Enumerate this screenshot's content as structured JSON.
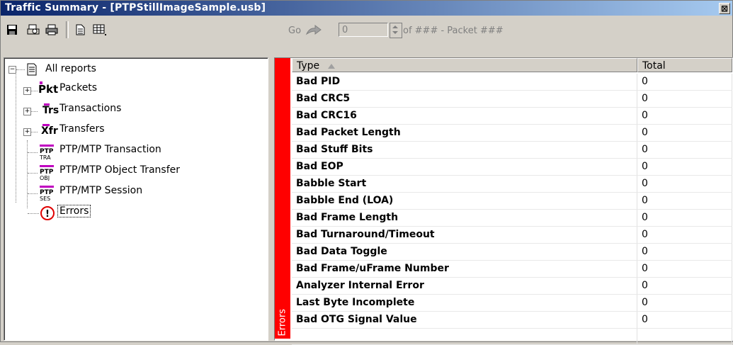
{
  "window": {
    "title": "Traffic Summary - [PTPStillImageSample.usb]",
    "close_glyph": "⊠"
  },
  "toolbar_left": {
    "icons": [
      "save-icon",
      "print-preview-icon",
      "print-icon",
      "report-icon",
      "table-view-icon"
    ]
  },
  "navigator": {
    "go_label": "Go",
    "input_value": "0",
    "of_text": "of ### - Packet ###"
  },
  "tree": {
    "root": "All reports",
    "items": [
      {
        "icon": "Pkt",
        "label": "Packets"
      },
      {
        "icon": "Trs",
        "label": "Transactions"
      },
      {
        "icon": "Xfr",
        "label": "Transfers"
      },
      {
        "icon": "PTP TRA",
        "label": "PTP/MTP Transaction"
      },
      {
        "icon": "PTP OBJ",
        "label": "PTP/MTP Object Transfer"
      },
      {
        "icon": "PTP SES",
        "label": "PTP/MTP Session"
      },
      {
        "icon": "!",
        "label": "Errors"
      }
    ]
  },
  "grid": {
    "side_label": "Errors",
    "columns": {
      "type": "Type",
      "total": "Total"
    },
    "rows": [
      {
        "type": "Bad PID",
        "total": "0"
      },
      {
        "type": "Bad CRC5",
        "total": "0"
      },
      {
        "type": "Bad CRC16",
        "total": "0"
      },
      {
        "type": "Bad Packet Length",
        "total": "0"
      },
      {
        "type": "Bad Stuff Bits",
        "total": "0"
      },
      {
        "type": "Bad EOP",
        "total": "0"
      },
      {
        "type": "Babble Start",
        "total": "0"
      },
      {
        "type": "Babble End (LOA)",
        "total": "0"
      },
      {
        "type": "Bad Frame Length",
        "total": "0"
      },
      {
        "type": "Bad Turnaround/Timeout",
        "total": "0"
      },
      {
        "type": "Bad Data Toggle",
        "total": "0"
      },
      {
        "type": "Bad Frame/uFrame Number",
        "total": "0"
      },
      {
        "type": "Analyzer Internal Error",
        "total": "0"
      },
      {
        "type": "Last Byte Incomplete",
        "total": "0"
      },
      {
        "type": "Bad OTG Signal Value",
        "total": "0"
      }
    ]
  }
}
